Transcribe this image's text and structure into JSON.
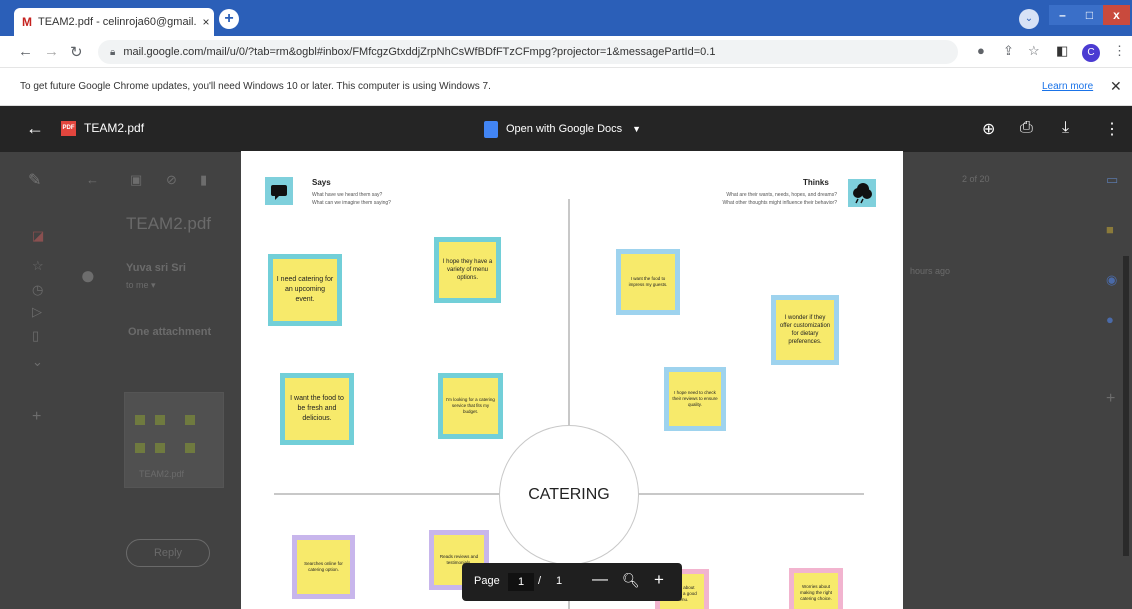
{
  "browser": {
    "tab_title": "TEAM2.pdf - celinroja60@gmail.",
    "tab_icon": "M",
    "tab_close": "×",
    "new_tab": "+",
    "win_min": "–",
    "win_max": "□",
    "win_close": "x",
    "url": "mail.google.com/mail/u/0/?tab=rm&ogbl#inbox/FMfcgzGtxddjZrpNhCsWfBDfFTzCFmpg?projector=1&messagePartId=0.1",
    "avatar_letter": "C",
    "profile_letter": "⌄"
  },
  "infobar": {
    "message": "To get future Google Chrome updates, you'll need Windows 10 or later. This computer is using Windows 7.",
    "learn_more": "Learn more",
    "close": "✕"
  },
  "viewer": {
    "file_name": "TEAM2.pdf",
    "pdf_badge": "PDF",
    "open_with": "Open with Google Docs"
  },
  "background": {
    "subject": "TEAM2.pdf",
    "sender": "Yuva sri Sri",
    "to_me": "to me ▾",
    "attachment": "One attachment",
    "attachment_name": "TEAM2.pdf",
    "reply": "Reply",
    "page_count": "2 of 20",
    "time": "hours ago"
  },
  "pdf": {
    "says": {
      "title": "Says",
      "subtitle_1": "What have we heard them say?",
      "subtitle_2": "What can we imagine them saying?"
    },
    "thinks": {
      "title": "Thinks",
      "subtitle_1": "What are their wants, needs, hopes, and dreams?",
      "subtitle_2": "What other thoughts might influence their behavior?"
    },
    "center": "CATERING",
    "notes": {
      "n1": "I need catering for an upcoming event.",
      "n2": "I hope they have a variety of menu options.",
      "n3": "I want the food to be fresh and delicious.",
      "n4": "I'm looking for a catering service that fits my budget.",
      "n5": "I want the food to impress my guests.",
      "n6": "I wonder if they offer customization for dietary preferences.",
      "n7": "I hope need to check their reviews to ensure quality.",
      "n8": "Searches online for catering option.",
      "n9": "Reads reviews and testimonials.",
      "n10": "Asked about making a good menu.",
      "n11": "Worries about making the right catering choice."
    }
  },
  "page_controls": {
    "label": "Page",
    "current": "1",
    "separator": "/",
    "total": "1"
  },
  "colors": {
    "titlebar": "#2b5fb8",
    "sticky": "#f7ea6b",
    "teal_frame": "#72cfd8"
  }
}
